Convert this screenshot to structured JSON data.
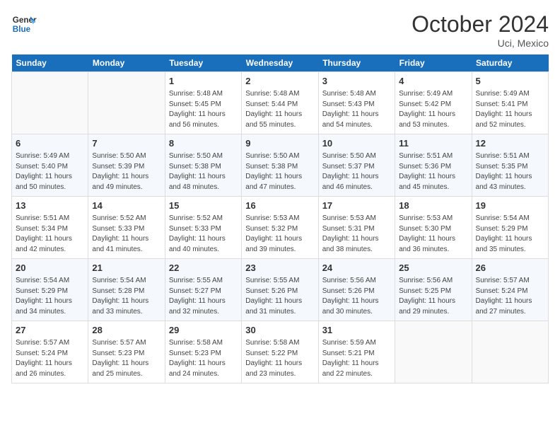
{
  "logo": {
    "line1": "General",
    "line2": "Blue"
  },
  "title": "October 2024",
  "location": "Uci, Mexico",
  "days_of_week": [
    "Sunday",
    "Monday",
    "Tuesday",
    "Wednesday",
    "Thursday",
    "Friday",
    "Saturday"
  ],
  "weeks": [
    [
      {
        "day": "",
        "empty": true
      },
      {
        "day": "",
        "empty": true
      },
      {
        "day": "1",
        "sunrise": "Sunrise: 5:48 AM",
        "sunset": "Sunset: 5:45 PM",
        "daylight": "Daylight: 11 hours and 56 minutes."
      },
      {
        "day": "2",
        "sunrise": "Sunrise: 5:48 AM",
        "sunset": "Sunset: 5:44 PM",
        "daylight": "Daylight: 11 hours and 55 minutes."
      },
      {
        "day": "3",
        "sunrise": "Sunrise: 5:48 AM",
        "sunset": "Sunset: 5:43 PM",
        "daylight": "Daylight: 11 hours and 54 minutes."
      },
      {
        "day": "4",
        "sunrise": "Sunrise: 5:49 AM",
        "sunset": "Sunset: 5:42 PM",
        "daylight": "Daylight: 11 hours and 53 minutes."
      },
      {
        "day": "5",
        "sunrise": "Sunrise: 5:49 AM",
        "sunset": "Sunset: 5:41 PM",
        "daylight": "Daylight: 11 hours and 52 minutes."
      }
    ],
    [
      {
        "day": "6",
        "sunrise": "Sunrise: 5:49 AM",
        "sunset": "Sunset: 5:40 PM",
        "daylight": "Daylight: 11 hours and 50 minutes."
      },
      {
        "day": "7",
        "sunrise": "Sunrise: 5:50 AM",
        "sunset": "Sunset: 5:39 PM",
        "daylight": "Daylight: 11 hours and 49 minutes."
      },
      {
        "day": "8",
        "sunrise": "Sunrise: 5:50 AM",
        "sunset": "Sunset: 5:38 PM",
        "daylight": "Daylight: 11 hours and 48 minutes."
      },
      {
        "day": "9",
        "sunrise": "Sunrise: 5:50 AM",
        "sunset": "Sunset: 5:38 PM",
        "daylight": "Daylight: 11 hours and 47 minutes."
      },
      {
        "day": "10",
        "sunrise": "Sunrise: 5:50 AM",
        "sunset": "Sunset: 5:37 PM",
        "daylight": "Daylight: 11 hours and 46 minutes."
      },
      {
        "day": "11",
        "sunrise": "Sunrise: 5:51 AM",
        "sunset": "Sunset: 5:36 PM",
        "daylight": "Daylight: 11 hours and 45 minutes."
      },
      {
        "day": "12",
        "sunrise": "Sunrise: 5:51 AM",
        "sunset": "Sunset: 5:35 PM",
        "daylight": "Daylight: 11 hours and 43 minutes."
      }
    ],
    [
      {
        "day": "13",
        "sunrise": "Sunrise: 5:51 AM",
        "sunset": "Sunset: 5:34 PM",
        "daylight": "Daylight: 11 hours and 42 minutes."
      },
      {
        "day": "14",
        "sunrise": "Sunrise: 5:52 AM",
        "sunset": "Sunset: 5:33 PM",
        "daylight": "Daylight: 11 hours and 41 minutes."
      },
      {
        "day": "15",
        "sunrise": "Sunrise: 5:52 AM",
        "sunset": "Sunset: 5:33 PM",
        "daylight": "Daylight: 11 hours and 40 minutes."
      },
      {
        "day": "16",
        "sunrise": "Sunrise: 5:53 AM",
        "sunset": "Sunset: 5:32 PM",
        "daylight": "Daylight: 11 hours and 39 minutes."
      },
      {
        "day": "17",
        "sunrise": "Sunrise: 5:53 AM",
        "sunset": "Sunset: 5:31 PM",
        "daylight": "Daylight: 11 hours and 38 minutes."
      },
      {
        "day": "18",
        "sunrise": "Sunrise: 5:53 AM",
        "sunset": "Sunset: 5:30 PM",
        "daylight": "Daylight: 11 hours and 36 minutes."
      },
      {
        "day": "19",
        "sunrise": "Sunrise: 5:54 AM",
        "sunset": "Sunset: 5:29 PM",
        "daylight": "Daylight: 11 hours and 35 minutes."
      }
    ],
    [
      {
        "day": "20",
        "sunrise": "Sunrise: 5:54 AM",
        "sunset": "Sunset: 5:29 PM",
        "daylight": "Daylight: 11 hours and 34 minutes."
      },
      {
        "day": "21",
        "sunrise": "Sunrise: 5:54 AM",
        "sunset": "Sunset: 5:28 PM",
        "daylight": "Daylight: 11 hours and 33 minutes."
      },
      {
        "day": "22",
        "sunrise": "Sunrise: 5:55 AM",
        "sunset": "Sunset: 5:27 PM",
        "daylight": "Daylight: 11 hours and 32 minutes."
      },
      {
        "day": "23",
        "sunrise": "Sunrise: 5:55 AM",
        "sunset": "Sunset: 5:26 PM",
        "daylight": "Daylight: 11 hours and 31 minutes."
      },
      {
        "day": "24",
        "sunrise": "Sunrise: 5:56 AM",
        "sunset": "Sunset: 5:26 PM",
        "daylight": "Daylight: 11 hours and 30 minutes."
      },
      {
        "day": "25",
        "sunrise": "Sunrise: 5:56 AM",
        "sunset": "Sunset: 5:25 PM",
        "daylight": "Daylight: 11 hours and 29 minutes."
      },
      {
        "day": "26",
        "sunrise": "Sunrise: 5:57 AM",
        "sunset": "Sunset: 5:24 PM",
        "daylight": "Daylight: 11 hours and 27 minutes."
      }
    ],
    [
      {
        "day": "27",
        "sunrise": "Sunrise: 5:57 AM",
        "sunset": "Sunset: 5:24 PM",
        "daylight": "Daylight: 11 hours and 26 minutes."
      },
      {
        "day": "28",
        "sunrise": "Sunrise: 5:57 AM",
        "sunset": "Sunset: 5:23 PM",
        "daylight": "Daylight: 11 hours and 25 minutes."
      },
      {
        "day": "29",
        "sunrise": "Sunrise: 5:58 AM",
        "sunset": "Sunset: 5:23 PM",
        "daylight": "Daylight: 11 hours and 24 minutes."
      },
      {
        "day": "30",
        "sunrise": "Sunrise: 5:58 AM",
        "sunset": "Sunset: 5:22 PM",
        "daylight": "Daylight: 11 hours and 23 minutes."
      },
      {
        "day": "31",
        "sunrise": "Sunrise: 5:59 AM",
        "sunset": "Sunset: 5:21 PM",
        "daylight": "Daylight: 11 hours and 22 minutes."
      },
      {
        "day": "",
        "empty": true
      },
      {
        "day": "",
        "empty": true
      }
    ]
  ]
}
